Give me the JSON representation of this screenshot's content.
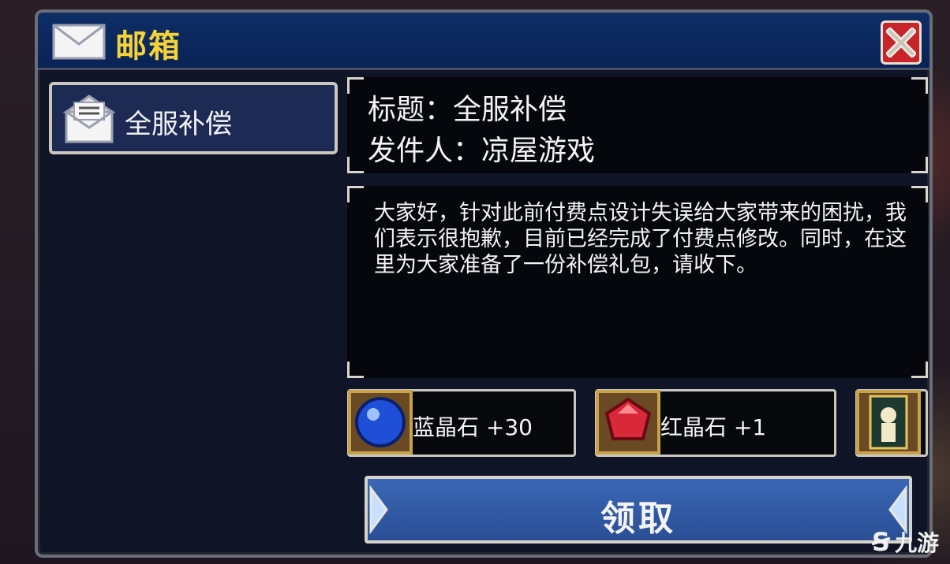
{
  "window": {
    "title": "邮箱",
    "close_icon": "close-icon"
  },
  "mail_list": [
    {
      "label": "全服补偿",
      "icon": "mail-open-icon"
    }
  ],
  "mail_detail": {
    "subject_label": "标题：全服补偿",
    "sender_label": "发件人：凉屋游戏",
    "body": "大家好，针对此前付费点设计失误给大家带来的困扰，我们表示很抱歉，目前已经完成了付费点修改。同时，在这里为大家准备了一份补偿礼包，请收下。"
  },
  "rewards": [
    {
      "label": "蓝晶石 +30",
      "icon": "blue-gem-icon",
      "color": "#1f4fd6"
    },
    {
      "label": "红晶石 +1",
      "icon": "red-gem-icon",
      "color": "#d8283a"
    },
    {
      "label": "",
      "icon": "card-icon",
      "color": "#e6c75a"
    }
  ],
  "claim_button": {
    "label": "领取"
  },
  "watermark": {
    "text": "九游"
  },
  "colors": {
    "title_text": "#f3d23a",
    "titlebar": "#0e2e66",
    "claim_button": "#3a67b4",
    "close_button": "#c7242b"
  }
}
